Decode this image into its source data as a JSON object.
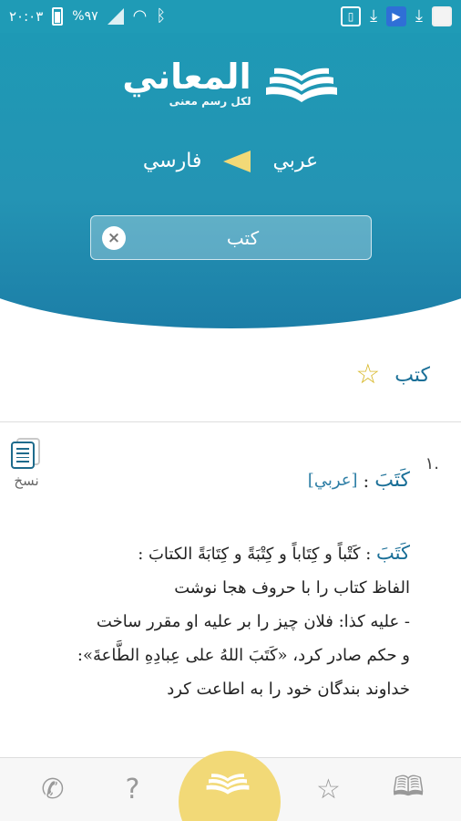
{
  "status_bar": {
    "time": "٢٠:٠٣",
    "battery": "%٩٧"
  },
  "app": {
    "name": "المعاني",
    "slogan": "لكل رسم معنى"
  },
  "languages": {
    "from": "عربي",
    "to": "فارسي"
  },
  "search": {
    "value": "كتب",
    "clear_label": "×"
  },
  "result": {
    "word": "كتب"
  },
  "copy": {
    "label": "نسخ"
  },
  "entry": {
    "number": "١.",
    "word": "كَتَبَ",
    "colon": ":",
    "source": "[عربي]",
    "headword": "كَتَبَ",
    "line1": " : كَتْباً و كِتَاباً و كِتْبَةً و كِتَابَةً الكتابَ :",
    "line2": "الفاظ كتاب را با حروف هجا نوشت",
    "line3": "- عليه كذا: فلان چيز را بر عليه او مقرر ساخت",
    "line4": "و حكم صادر كرد، «كَتَبَ اللهُ على عِبادِهِ الطَّاعةَ»:",
    "line5": "خداوند بندگان خود را به اطاعت كرد"
  },
  "colors": {
    "header": "#1d9ab5",
    "accent": "#f2d977",
    "link": "#1a6f97"
  },
  "icons": {
    "bottom_nav": [
      "phone-icon",
      "question-icon",
      "book-icon",
      "star-icon",
      "open-book-icon"
    ]
  }
}
